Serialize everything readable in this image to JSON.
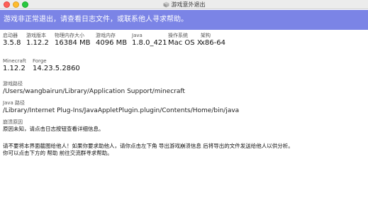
{
  "window": {
    "title": "游戏意外退出"
  },
  "banner": {
    "text": "游戏非正常退出，请查看日志文件，或联系他人寻求帮助。"
  },
  "info": [
    {
      "label": "启动器",
      "value": "3.5.8"
    },
    {
      "label": "游戏版本",
      "value": "1.12.2"
    },
    {
      "label": "物理内存大小",
      "value": "16384 MB"
    },
    {
      "label": "游戏内存",
      "value": "4096 MB"
    },
    {
      "label": "Java",
      "value": "1.8.0_421"
    },
    {
      "label": "操作系统",
      "value": "Mac OS X"
    },
    {
      "label": "架构",
      "value": "x86-64"
    }
  ],
  "loaders": [
    {
      "label": "Minecraft",
      "value": "1.12.2"
    },
    {
      "label": "Forge",
      "value": "14.23.5.2860"
    }
  ],
  "game_path": {
    "label": "游戏路径",
    "value": "/Users/wangbairun/Library/Application Support/minecraft"
  },
  "java_path": {
    "label": "Java 路径",
    "value": "/Library/Internet Plug-Ins/JavaAppletPlugin.plugin/Contents/Home/bin/java"
  },
  "crash": {
    "label": "崩溃原因",
    "value": "原因未知，请点击日志按钮查看详细信息。"
  },
  "notice": {
    "line1": "请不要将本界面截图给他人！如果你要求助他人，请你点击左下角 导出游戏崩溃信息 后将导出的文件发送给他人以供分析。",
    "line2": "你可以点击下方的 帮助 前往交流群寻求帮助。"
  }
}
